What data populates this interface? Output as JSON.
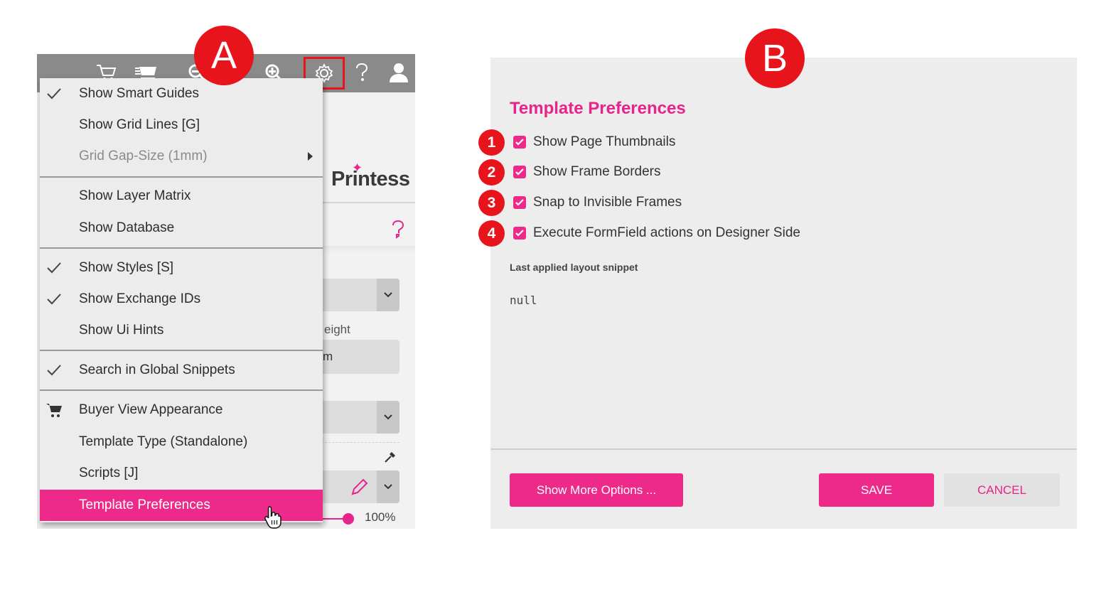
{
  "callouts": {
    "a": "A",
    "b": "B",
    "numbers": [
      "1",
      "2",
      "3",
      "4"
    ]
  },
  "toolbar": {
    "icons": [
      "cart-icon",
      "cart-list-icon",
      "zoom-out-icon",
      "zoom-in-icon",
      "gear-icon",
      "help-icon",
      "user-icon"
    ]
  },
  "menu": {
    "items": [
      {
        "label": "Show Smart Guides",
        "checked": true
      },
      {
        "label": "Show Grid Lines [G]",
        "checked": false
      },
      {
        "label": "Grid Gap-Size (1mm)",
        "disabled": true,
        "submenu": true
      },
      {
        "label": "Show Layer Matrix",
        "checked": false
      },
      {
        "label": "Show Database",
        "checked": false
      },
      {
        "label": "Show Styles [S]",
        "checked": true
      },
      {
        "label": "Show Exchange IDs",
        "checked": true
      },
      {
        "label": "Show Ui Hints",
        "checked": false
      },
      {
        "label": "Search in Global Snippets",
        "checked": true
      },
      {
        "label": "Buyer View Appearance",
        "icon": "cart-icon"
      },
      {
        "label": "Template Type (Standalone)"
      },
      {
        "label": "Scripts [J]"
      },
      {
        "label": "Template Preferences",
        "active": true
      }
    ]
  },
  "side": {
    "brand": "Printess",
    "height_label": "eight",
    "unit_partial": "m",
    "opacity": "100%"
  },
  "preferences": {
    "title": "Template Preferences",
    "options": [
      {
        "label": "Show Page Thumbnails",
        "checked": true
      },
      {
        "label": "Show Frame Borders",
        "checked": true
      },
      {
        "label": "Snap to Invisible Frames",
        "checked": true
      },
      {
        "label": "Execute FormField actions on Designer Side",
        "checked": true
      }
    ],
    "snippet_label": "Last applied layout snippet",
    "snippet_value": "null",
    "buttons": {
      "more": "Show More Options ...",
      "save": "SAVE",
      "cancel": "CANCEL"
    }
  },
  "colors": {
    "accent": "#ed2a8a",
    "badge": "#e8141b",
    "toolbar": "#8a8a8a"
  }
}
